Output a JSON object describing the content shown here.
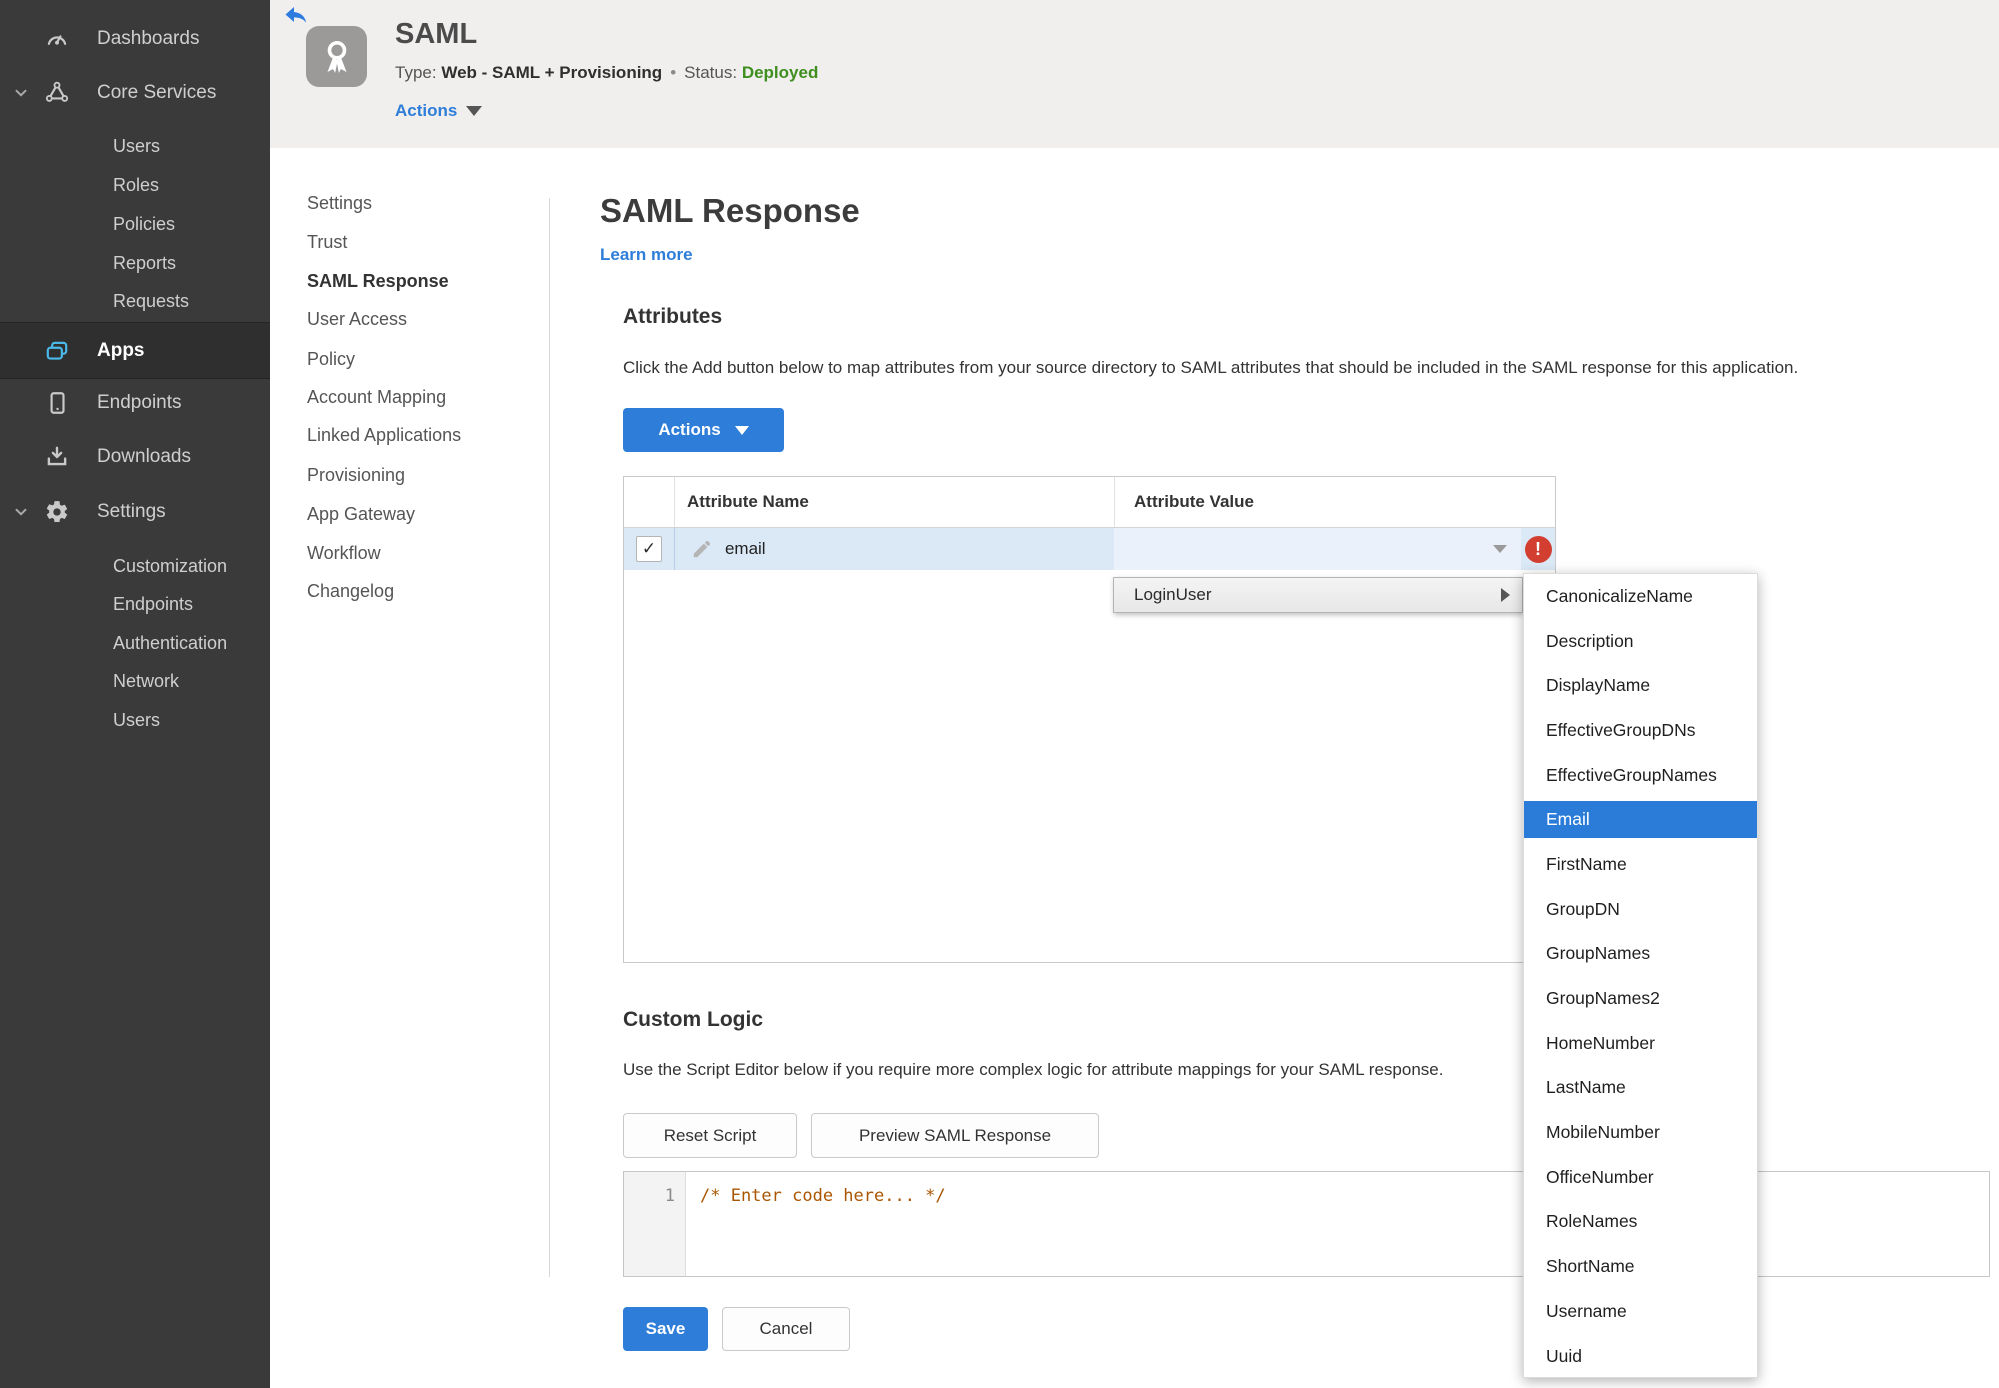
{
  "colors": {
    "accent_blue": "#2e7ed9",
    "menu_highlight_blue": "#2a7cd8",
    "status_green": "#3f8e20",
    "error_red": "#d23f31",
    "sidebar_bg": "#3a3a3a",
    "header_bg": "#f0efee",
    "selected_row_blue": "#dbe8f6"
  },
  "sidebar": {
    "dashboards": "Dashboards",
    "core_services": "Core Services",
    "core_children": [
      "Users",
      "Roles",
      "Policies",
      "Reports",
      "Requests"
    ],
    "apps": "Apps",
    "endpoints": "Endpoints",
    "downloads": "Downloads",
    "settings": "Settings",
    "settings_children": [
      "Customization",
      "Endpoints",
      "Authentication",
      "Network",
      "Users"
    ]
  },
  "app_header": {
    "title": "SAML",
    "type_label": "Type:",
    "type_value": "Web - SAML + Provisioning",
    "separator": "•",
    "status_label": "Status:",
    "status_value": "Deployed",
    "actions_label": "Actions"
  },
  "subnav": {
    "items": [
      "Settings",
      "Trust",
      "SAML Response",
      "User Access",
      "Policy",
      "Account Mapping",
      "Linked Applications",
      "Provisioning",
      "App Gateway",
      "Workflow",
      "Changelog"
    ],
    "active": "SAML Response"
  },
  "main": {
    "title": "SAML Response",
    "learn_more": "Learn more",
    "attributes": {
      "heading": "Attributes",
      "description": "Click the Add button below to map attributes from your source directory to SAML attributes that should be included in the SAML response for this application.",
      "actions_button": "Actions",
      "table": {
        "columns": [
          "Attribute Name",
          "Attribute Value"
        ],
        "row": {
          "checked": true,
          "check_glyph": "✓",
          "name": "email",
          "value": "",
          "error": true,
          "error_glyph": "!"
        }
      }
    },
    "value_menu": {
      "trigger": "LoginUser",
      "selected": "Email",
      "items": [
        "CanonicalizeName",
        "Description",
        "DisplayName",
        "EffectiveGroupDNs",
        "EffectiveGroupNames",
        "Email",
        "FirstName",
        "GroupDN",
        "GroupNames",
        "GroupNames2",
        "HomeNumber",
        "LastName",
        "MobileNumber",
        "OfficeNumber",
        "RoleNames",
        "ShortName",
        "Username",
        "Uuid"
      ]
    },
    "custom_logic": {
      "heading": "Custom Logic",
      "description": "Use the Script Editor below if you require more complex logic for attribute mappings for your SAML response.",
      "reset_button": "Reset Script",
      "preview_button": "Preview SAML Response",
      "editor": {
        "line_number": "1",
        "code": "/* Enter code here... */"
      }
    },
    "footer": {
      "save": "Save",
      "cancel": "Cancel"
    }
  }
}
